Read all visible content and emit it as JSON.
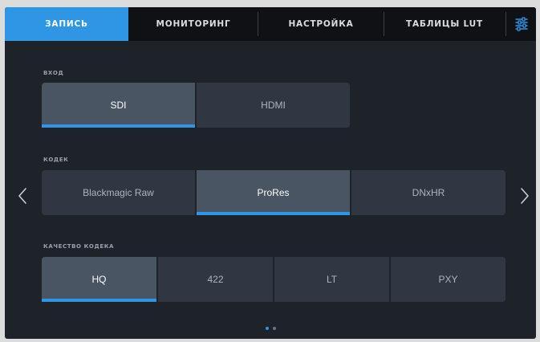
{
  "tabs": [
    {
      "label": "ЗАПИСЬ",
      "active": true
    },
    {
      "label": "МОНИТОРИНГ",
      "active": false
    },
    {
      "label": "НАСТРОЙКА",
      "active": false
    },
    {
      "label": "ТАБЛИЦЫ LUT",
      "active": false
    }
  ],
  "settings_icon": "sliders-icon",
  "input": {
    "label": "ВХОД",
    "options": [
      {
        "label": "SDI",
        "selected": true
      },
      {
        "label": "HDMI",
        "selected": false
      }
    ]
  },
  "codec": {
    "label": "КОДЕК",
    "options": [
      {
        "label": "Blackmagic Raw",
        "selected": false
      },
      {
        "label": "ProRes",
        "selected": true
      },
      {
        "label": "DNxHR",
        "selected": false
      }
    ]
  },
  "codec_quality": {
    "label": "КАЧЕСТВО КОДЕКА",
    "options": [
      {
        "label": "HQ",
        "selected": true
      },
      {
        "label": "422",
        "selected": false
      },
      {
        "label": "LT",
        "selected": false
      },
      {
        "label": "PXY",
        "selected": false
      }
    ]
  },
  "pagination": {
    "pages": 2,
    "current": 1
  },
  "colors": {
    "accent": "#2f96e6",
    "background": "#1e2229",
    "tabbar": "#0f1114",
    "segment": "#313742",
    "segment_selected": "#4a5563"
  }
}
